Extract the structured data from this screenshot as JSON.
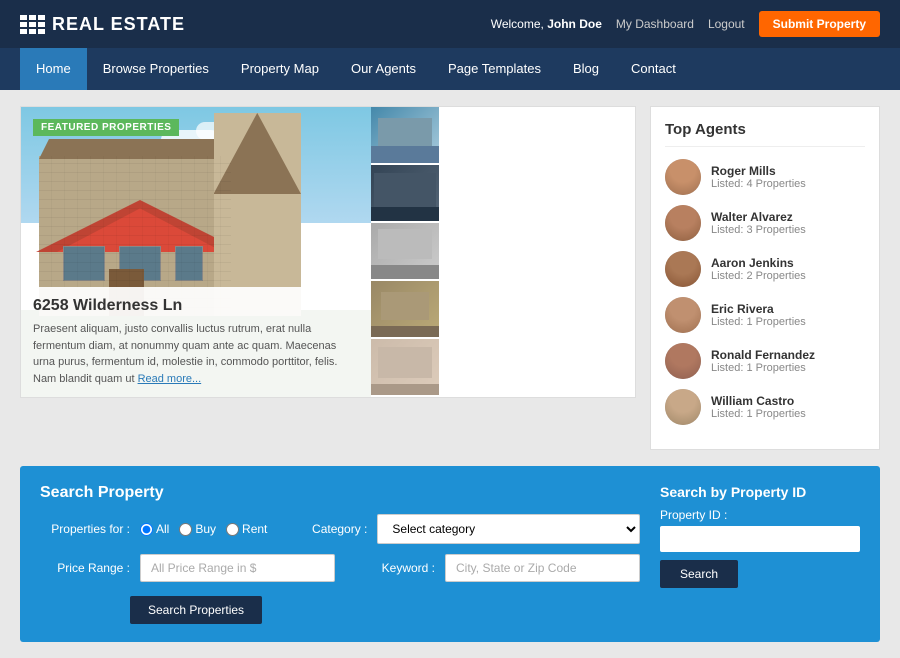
{
  "header": {
    "logo": "REAL ESTATE",
    "welcome": "Welcome,",
    "username": "John Doe",
    "dashboard": "My Dashboard",
    "logout": "Logout",
    "submit": "Submit Property"
  },
  "nav": {
    "items": [
      {
        "label": "Home",
        "active": true
      },
      {
        "label": "Browse Properties",
        "active": false
      },
      {
        "label": "Property Map",
        "active": false
      },
      {
        "label": "Our Agents",
        "active": false
      },
      {
        "label": "Page Templates",
        "active": false
      },
      {
        "label": "Blog",
        "active": false
      },
      {
        "label": "Contact",
        "active": false
      }
    ]
  },
  "featured": {
    "badge": "FEATURED PROPERTIES",
    "property_name": "6258 Wilderness Ln",
    "description": "Praesent aliquam, justo convallis luctus rutrum, erat nulla fermentum diam, at nonummy quam ante ac quam. Maecenas urna purus, fermentum id, molestie in, commodo porttitor, felis. Nam blandit quam ut",
    "read_more": "Read more..."
  },
  "agents": {
    "title": "Top Agents",
    "list": [
      {
        "name": "Roger Mills",
        "listed": "Listed: 4 Properties"
      },
      {
        "name": "Walter Alvarez",
        "listed": "Listed: 3 Properties"
      },
      {
        "name": "Aaron Jenkins",
        "listed": "Listed: 2 Properties"
      },
      {
        "name": "Eric Rivera",
        "listed": "Listed: 1 Properties"
      },
      {
        "name": "Ronald Fernandez",
        "listed": "Listed: 1 Properties"
      },
      {
        "name": "William Castro",
        "listed": "Listed: 1 Properties"
      }
    ]
  },
  "search": {
    "title": "Search Property",
    "properties_for_label": "Properties for :",
    "radio_all": "All",
    "radio_buy": "Buy",
    "radio_rent": "Rent",
    "category_label": "Category :",
    "category_placeholder": "Select category",
    "price_range_label": "Price Range :",
    "price_range_placeholder": "All Price Range in $",
    "keyword_label": "Keyword :",
    "keyword_placeholder": "City, State or Zip Code",
    "search_button": "Search Properties",
    "by_id_title": "Search by Property ID",
    "property_id_label": "Property ID :",
    "id_search_button": "Search"
  }
}
